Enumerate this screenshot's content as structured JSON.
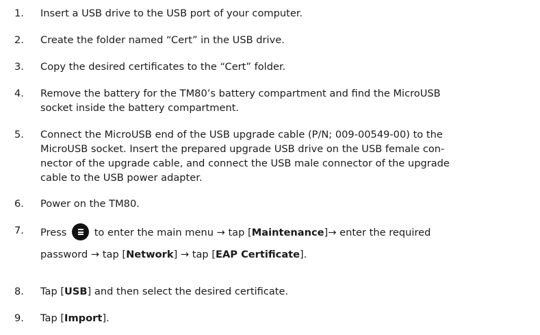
{
  "steps": [
    {
      "num": "1.",
      "text": "Insert a USB drive to the USB port of your computer."
    },
    {
      "num": "2.",
      "text": "Create the folder named “Cert” in the USB drive."
    },
    {
      "num": "3.",
      "text": "Copy the desired certificates to the “Cert” folder."
    },
    {
      "num": "4.",
      "line1": "Remove the battery for the TM80’s battery compartment and find the MicroUSB",
      "line2": "socket inside the battery compartment."
    },
    {
      "num": "5.",
      "line1": "Connect the MicroUSB end of the USB upgrade cable (P/N; 009-00549-00) to the",
      "line2": "MicroUSB socket. Insert the prepared upgrade USB drive on the USB female con-",
      "line3": "nector of the upgrade cable, and connect the USB male connector of the upgrade",
      "line4": "cable to the USB power adapter."
    },
    {
      "num": "6.",
      "text": "Power on the TM80."
    },
    {
      "num": "7.",
      "press": "Press",
      "after_icon": "to enter the main menu → tap [",
      "maintenance": "Maintenance",
      "after_maintenance": "]→ enter the required",
      "line2_start": "password → tap [",
      "network": "Network",
      "mid": "] → tap [",
      "eap": "EAP Certificate",
      "end": "].",
      "icon": "menu-button-icon"
    },
    {
      "num": "8.",
      "pre": "Tap [",
      "usb": "USB",
      "post": "] and then select the desired certificate."
    },
    {
      "num": "9.",
      "pre": "Tap [",
      "import": "Import",
      "post": "]."
    }
  ]
}
